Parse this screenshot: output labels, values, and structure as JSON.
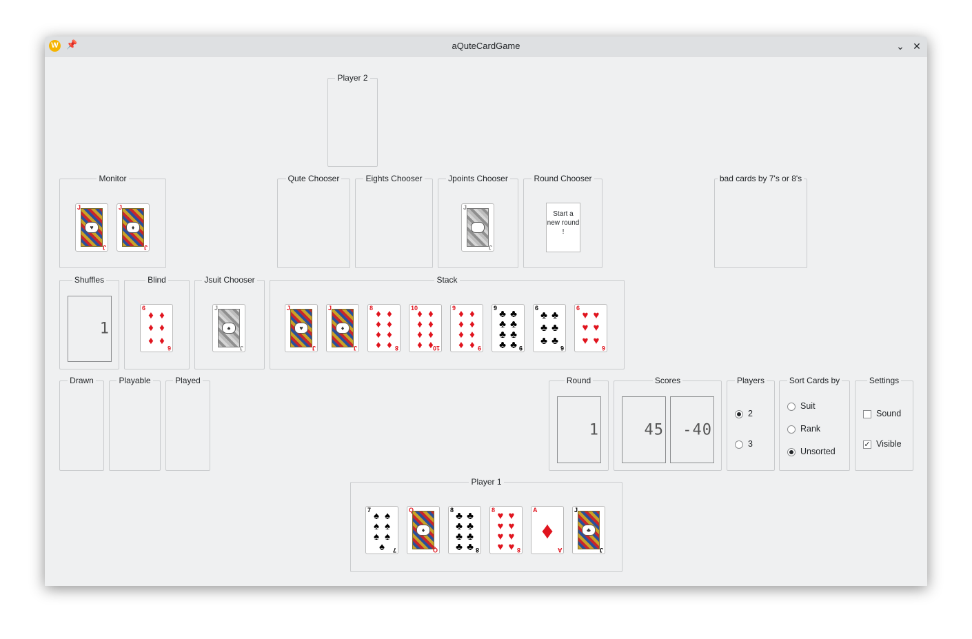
{
  "window": {
    "title": "aQuteCardGame"
  },
  "titlebar": {
    "app_icon": "W",
    "pin_icon": "📌",
    "minimize_icon": "⌄",
    "close_icon": "✕"
  },
  "groups": {
    "player2": "Player 2",
    "monitor": "Monitor",
    "qute_chooser": "Qute Chooser",
    "eights_chooser": "Eights Chooser",
    "jpoints_chooser": "Jpoints Chooser",
    "round_chooser": "Round Chooser",
    "bad_cards": "bad cards by 7's or 8's",
    "shuffles": "Shuffles",
    "blind": "Blind",
    "jsuit_chooser": "Jsuit Chooser",
    "stack": "Stack",
    "drawn": "Drawn",
    "playable": "Playable",
    "played": "Played",
    "round": "Round",
    "scores": "Scores",
    "players": "Players",
    "sort_cards_by": "Sort Cards by",
    "settings": "Settings",
    "player1": "Player 1"
  },
  "round_chooser_card": "Start a new round !",
  "shuffles_value": "1",
  "round_value": "1",
  "scores": [
    "45",
    "-40"
  ],
  "players": {
    "options": [
      "2",
      "3"
    ],
    "selected": "2"
  },
  "sort": {
    "options": [
      "Suit",
      "Rank",
      "Unsorted"
    ],
    "selected": "Unsorted"
  },
  "settings": {
    "sound_label": "Sound",
    "sound_checked": false,
    "visible_label": "Visible",
    "visible_checked": true
  },
  "cards": {
    "monitor": [
      {
        "rank": "J",
        "suit": "♥",
        "color": "red"
      },
      {
        "rank": "J",
        "suit": "♦",
        "color": "red"
      }
    ],
    "jpoints": {
      "rank": "J",
      "suit": "",
      "color": "grey"
    },
    "blind": {
      "rank": "6",
      "suit": "♦",
      "color": "red"
    },
    "jsuit": {
      "rank": "J",
      "suit": "♠",
      "color": "grey"
    },
    "stack": [
      {
        "rank": "J",
        "suit": "♥",
        "color": "red"
      },
      {
        "rank": "J",
        "suit": "♦",
        "color": "red"
      },
      {
        "rank": "8",
        "suit": "♦",
        "color": "red"
      },
      {
        "rank": "10",
        "suit": "♦",
        "color": "red"
      },
      {
        "rank": "9",
        "suit": "♦",
        "color": "red"
      },
      {
        "rank": "9",
        "suit": "♣",
        "color": "black"
      },
      {
        "rank": "6",
        "suit": "♣",
        "color": "black"
      },
      {
        "rank": "6",
        "suit": "♥",
        "color": "red"
      }
    ],
    "player1": [
      {
        "rank": "7",
        "suit": "♠",
        "color": "black"
      },
      {
        "rank": "Q",
        "suit": "♦",
        "color": "red"
      },
      {
        "rank": "8",
        "suit": "♣",
        "color": "black"
      },
      {
        "rank": "8",
        "suit": "♥",
        "color": "red"
      },
      {
        "rank": "A",
        "suit": "♦",
        "color": "red"
      },
      {
        "rank": "J",
        "suit": "♣",
        "color": "black"
      }
    ]
  }
}
